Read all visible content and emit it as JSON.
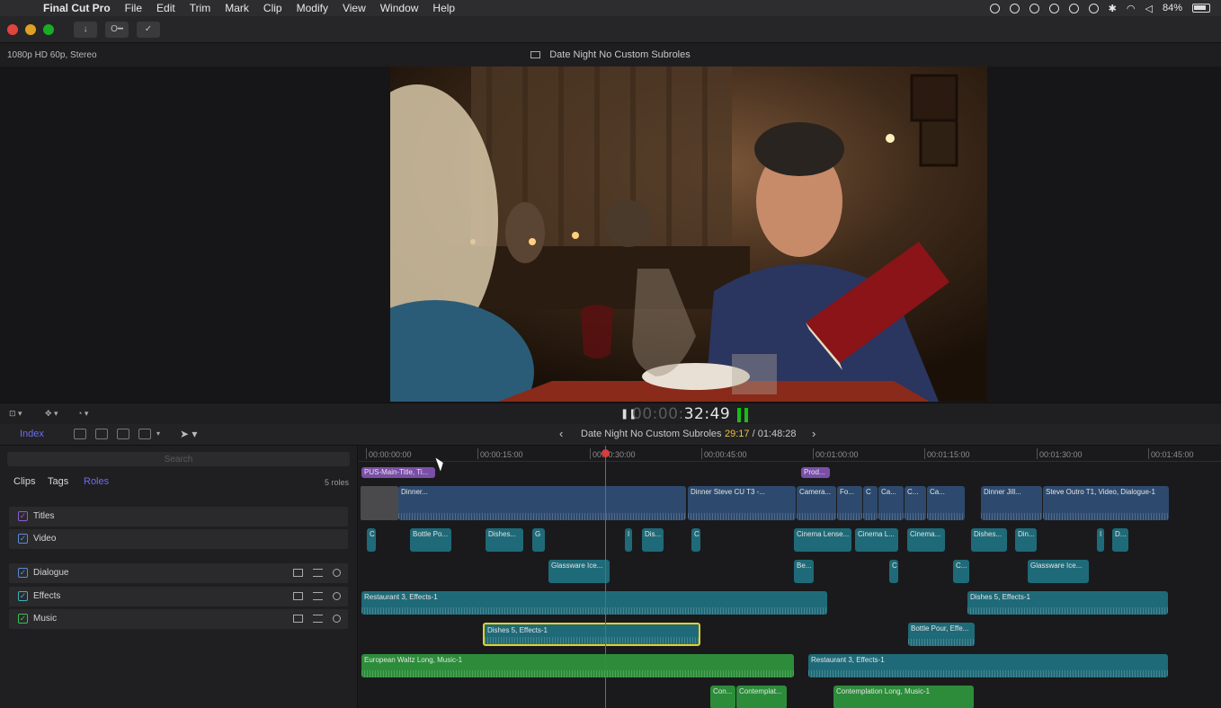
{
  "menubar": {
    "app_name": "Final Cut Pro",
    "items": [
      "File",
      "Edit",
      "Trim",
      "Mark",
      "Clip",
      "Modify",
      "View",
      "Window",
      "Help"
    ],
    "battery": "84%"
  },
  "toolbar": {
    "key_label": "O━"
  },
  "viewer": {
    "format": "1080p HD 60p, Stereo",
    "title": "Date Night No Custom Subroles"
  },
  "transport": {
    "timecode_dim": "00:00:",
    "timecode": "32:49"
  },
  "timeline_header": {
    "index_label": "Index",
    "project_name": "Date Night No Custom Subroles",
    "position_current": "29:17",
    "position_total": " / 01:48:28"
  },
  "index": {
    "search_placeholder": "Search",
    "tabs": [
      "Clips",
      "Tags",
      "Roles"
    ],
    "roles_count": "5 roles",
    "roles": [
      {
        "name": "Titles",
        "color": "#8a5cd0"
      },
      {
        "name": "Video",
        "color": "#5a8ad8"
      },
      {
        "name": "Dialogue",
        "color": "#5a8ad8"
      },
      {
        "name": "Effects",
        "color": "#3ab0c0"
      },
      {
        "name": "Music",
        "color": "#3ac050"
      }
    ]
  },
  "ruler": [
    "00:00:00:00",
    "00:00:15:00",
    "00:00:30:00",
    "00:00:45:00",
    "00:01:00:00",
    "00:01:15:00",
    "00:01:30:00",
    "00:01:45:00"
  ],
  "clips": {
    "title1": "PUS-Main-Title, Ti...",
    "title2": "Prod...",
    "v1": "Dinner...",
    "v2": "Dinner Steve CU T3 -...",
    "v3": "Camera...",
    "v4": "Fo...",
    "v5": "C",
    "v6": "Ca...",
    "v7": "C...",
    "v8": "Ca...",
    "v9": "Dinner Jill...",
    "v10": "Steve Outro T1, Video, Dialogue-1",
    "c1": "C",
    "c2": "Bottle Po...",
    "c3": "Dishes...",
    "c4": "G",
    "c5": "I",
    "c6": "Dis...",
    "c7": "C",
    "c8": "Cinema Lense...",
    "c9": "Cinema L...",
    "c10": "Cinema...",
    "c11": "Dishes...",
    "c12": "Din...",
    "c13": "I",
    "c14": "D...",
    "g1": "Glassware Ice...",
    "g2": "Be...",
    "g3": "C",
    "g4": "C...",
    "g5": "Glassware Ice...",
    "e1": "Restaurant 3, Effects-1",
    "e2": "Dishes 5, Effects-1",
    "e3": "Dishes 5, Effects-1",
    "e4": "Bottle Pour, Effe...",
    "m1": "European Waltz Long, Music-1",
    "e5": "Restaurant 3, Effects-1",
    "m2": "Con...",
    "m3": "Contemplat...",
    "m4": "Contemplation Long, Music-1"
  }
}
